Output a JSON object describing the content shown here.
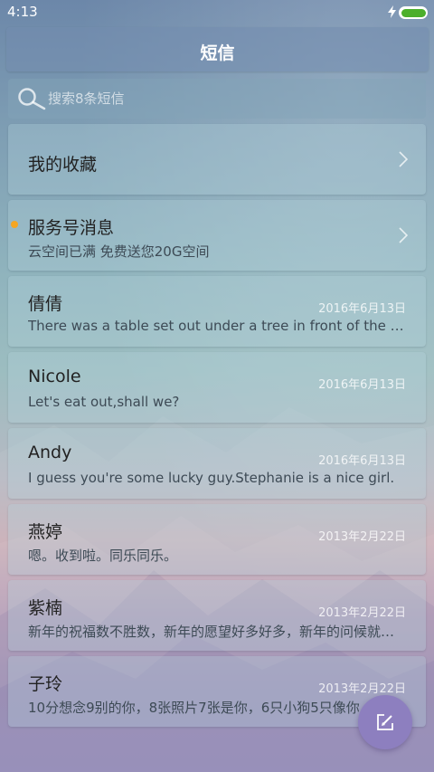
{
  "status_bar": {
    "time": "4:13",
    "charging_icon": "bolt-icon",
    "battery_level": 1.0,
    "battery_color": "#4caf2c"
  },
  "header": {
    "title": "短信"
  },
  "search": {
    "placeholder": "搜索8条短信",
    "icon": "search-icon"
  },
  "conversations": [
    {
      "title": "我的收藏",
      "subtitle": "",
      "date": "",
      "chevron": true,
      "unread": false
    },
    {
      "title": "服务号消息",
      "subtitle": "云空间已满 免费送您20G空间",
      "date": "",
      "chevron": true,
      "unread": true
    },
    {
      "title": "倩倩",
      "subtitle": "There was a table set out under a tree in front of the house",
      "date": "2016年6月13日",
      "chevron": false,
      "unread": false
    },
    {
      "title": "Nicole",
      "subtitle": "Let's eat out,shall we?",
      "date": "2016年6月13日",
      "chevron": false,
      "unread": false
    },
    {
      "title": "Andy",
      "subtitle": "I guess you're some lucky guy.Stephanie is a nice girl.",
      "date": "2016年6月13日",
      "chevron": false,
      "unread": false
    },
    {
      "title": "燕婷",
      "subtitle": "嗯。收到啦。同乐同乐。",
      "date": "2013年2月22日",
      "chevron": false,
      "unread": false
    },
    {
      "title": "紫楠",
      "subtitle": "新年的祝福数不胜数，新年的愿望好多好多，新年的问候就一句",
      "date": "2013年2月22日",
      "chevron": false,
      "unread": false
    },
    {
      "title": "子玲",
      "subtitle": "10分想念9别的你，8张照片7张是你，6只小狗5只像你",
      "date": "2013年2月22日",
      "chevron": false,
      "unread": false
    }
  ],
  "fab": {
    "icon": "compose-icon",
    "color": "#8d7fbf"
  },
  "colors": {
    "unread_dot": "#f5a623"
  }
}
